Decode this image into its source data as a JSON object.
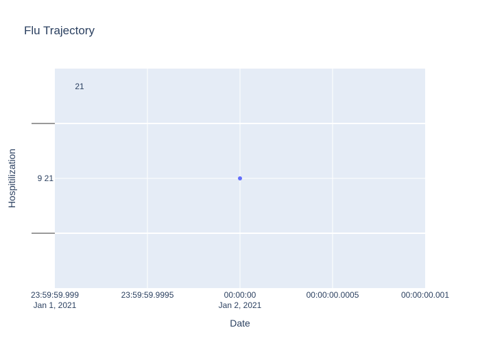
{
  "chart_data": {
    "type": "scatter",
    "title": "Flu Trajectory",
    "xlabel": "Date",
    "ylabel": "Hospitilization",
    "x_axis": {
      "type": "date",
      "range_ms": [
        -1,
        1
      ],
      "ticks": [
        {
          "v": -1,
          "line1": "23:59:59.999",
          "line2": "Jan 1, 2021"
        },
        {
          "v": -0.5,
          "line1": "23:59:59.9995",
          "line2": ""
        },
        {
          "v": 0,
          "line1": "00:00:00",
          "line2": "Jan 2, 2021"
        },
        {
          "v": 0.5,
          "line1": "00:00:00.0005",
          "line2": ""
        },
        {
          "v": 1,
          "line1": "00:00:00.001",
          "line2": ""
        }
      ]
    },
    "y_axis": {
      "range": [
        20,
        22
      ],
      "ticks": [
        {
          "v": 20.5,
          "label": ""
        },
        {
          "v": 21,
          "label": "9  21"
        },
        {
          "v": 21.5,
          "label": ""
        }
      ]
    },
    "series": [
      {
        "x": [
          "2021-01-02 00:00:00"
        ],
        "y": [
          21
        ],
        "color": "#636efa"
      }
    ],
    "annotations": [
      {
        "text": "21"
      }
    ],
    "grid": true,
    "plot_bg": "#e5ecf6"
  }
}
